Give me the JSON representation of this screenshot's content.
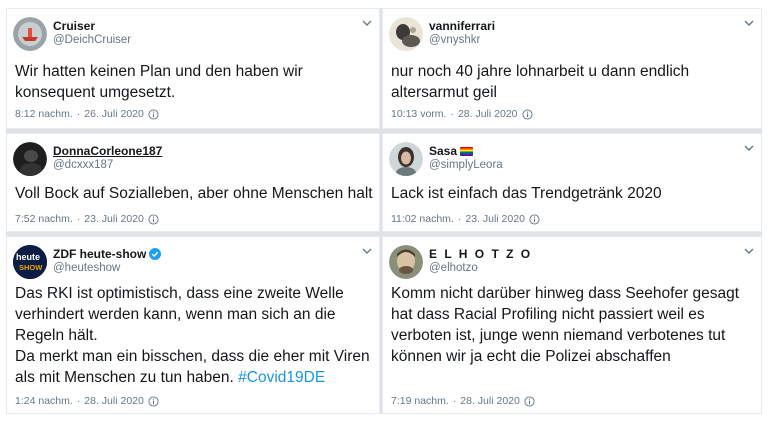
{
  "colors": {
    "link": "#1b95e0",
    "meta": "#657786",
    "text": "#14171a",
    "verified": "#1da1f2"
  },
  "tweets": [
    {
      "name": "Cruiser",
      "handle": "@DeichCruiser",
      "text": "Wir hatten keinen Plan und den haben wir konsequent umgesetzt.",
      "time": "8:12 nachm.",
      "dot": "·",
      "date": "26. Juli 2020",
      "avatar_icon": "ship-avatar"
    },
    {
      "name": "vanniferrari",
      "handle": "@vnyshkr",
      "text": "nur noch 40 jahre lohnarbeit u dann endlich altersarmut geil",
      "time": "10:13 vorm.",
      "dot": "·",
      "date": "28. Juli 2020",
      "avatar_icon": "photo-avatar"
    },
    {
      "name": "DonnaCorleone187",
      "handle": "@dcxxx187",
      "text": "Voll Bock auf Sozialleben, aber ohne Menschen halt",
      "time": "7:52 nachm.",
      "dot": "·",
      "date": "23. Juli 2020",
      "avatar_icon": "dark-avatar"
    },
    {
      "name": "Sasa",
      "handle": "@simplyLeora",
      "text": "Lack ist einfach das Trendgetränk 2020",
      "time": "11:02 nachm.",
      "dot": "·",
      "date": "23. Juli 2020",
      "avatar_icon": "portrait-avatar",
      "name_emoji": "rainbow-flag-icon"
    },
    {
      "name": "ZDF heute-show",
      "handle": "@heuteshow",
      "text_main": "Das RKI ist optimistisch, dass eine zweite Welle verhindert werden kann, wenn man sich an die Regeln hält.\nDa merkt man ein bisschen, dass die eher mit Viren als mit Menschen zu tun haben. ",
      "hashtag": "#Covid19DE",
      "time": "1:24 nachm.",
      "dot": "·",
      "date": "28. Juli 2020",
      "avatar_icon": "heute-show-logo",
      "avatar_logo_line1": "heute",
      "avatar_logo_line2": "SHOW",
      "verified": true
    },
    {
      "name": "E L H O T Z O",
      "handle": "@elhotzo",
      "text": "Komm nicht darüber hinweg dass Seehofer gesagt hat dass Racial Profiling nicht passiert weil es verboten ist, junge wenn niemand verbotenes tut können wir ja echt die Polizei abschaffen",
      "time": "7:19 nachm.",
      "dot": "·",
      "date": "28. Juli 2020",
      "avatar_icon": "face-avatar"
    }
  ]
}
